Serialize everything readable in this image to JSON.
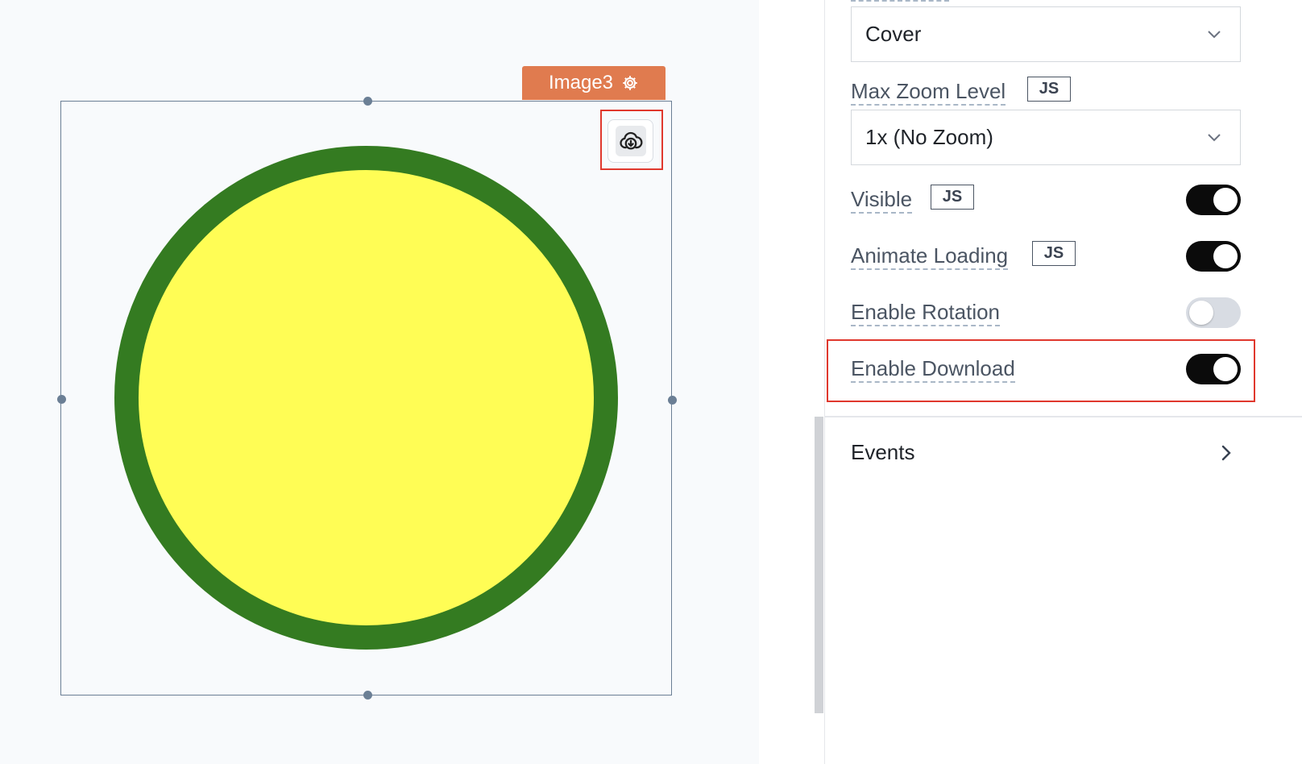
{
  "canvas": {
    "widget_name": "Image3",
    "image_colors": {
      "fill": "#fffd55",
      "stroke": "#347b21"
    },
    "download_icon": "cloud-download-icon",
    "settings_icon": "gear-icon"
  },
  "panel": {
    "object_fit": {
      "value": "Cover"
    },
    "max_zoom": {
      "label": "Max Zoom Level",
      "js": "JS",
      "value": "1x (No Zoom)"
    },
    "visible": {
      "label": "Visible",
      "js": "JS",
      "on": true
    },
    "animate_loading": {
      "label": "Animate Loading",
      "js": "JS",
      "on": true
    },
    "enable_rotation": {
      "label": "Enable Rotation",
      "on": false
    },
    "enable_download": {
      "label": "Enable Download",
      "on": true
    },
    "events": {
      "label": "Events"
    }
  },
  "colors": {
    "accent_tag": "#e07b4f",
    "highlight": "#e0382d",
    "toggle_on": "#0b0b0b",
    "toggle_off": "#d8dce3"
  }
}
